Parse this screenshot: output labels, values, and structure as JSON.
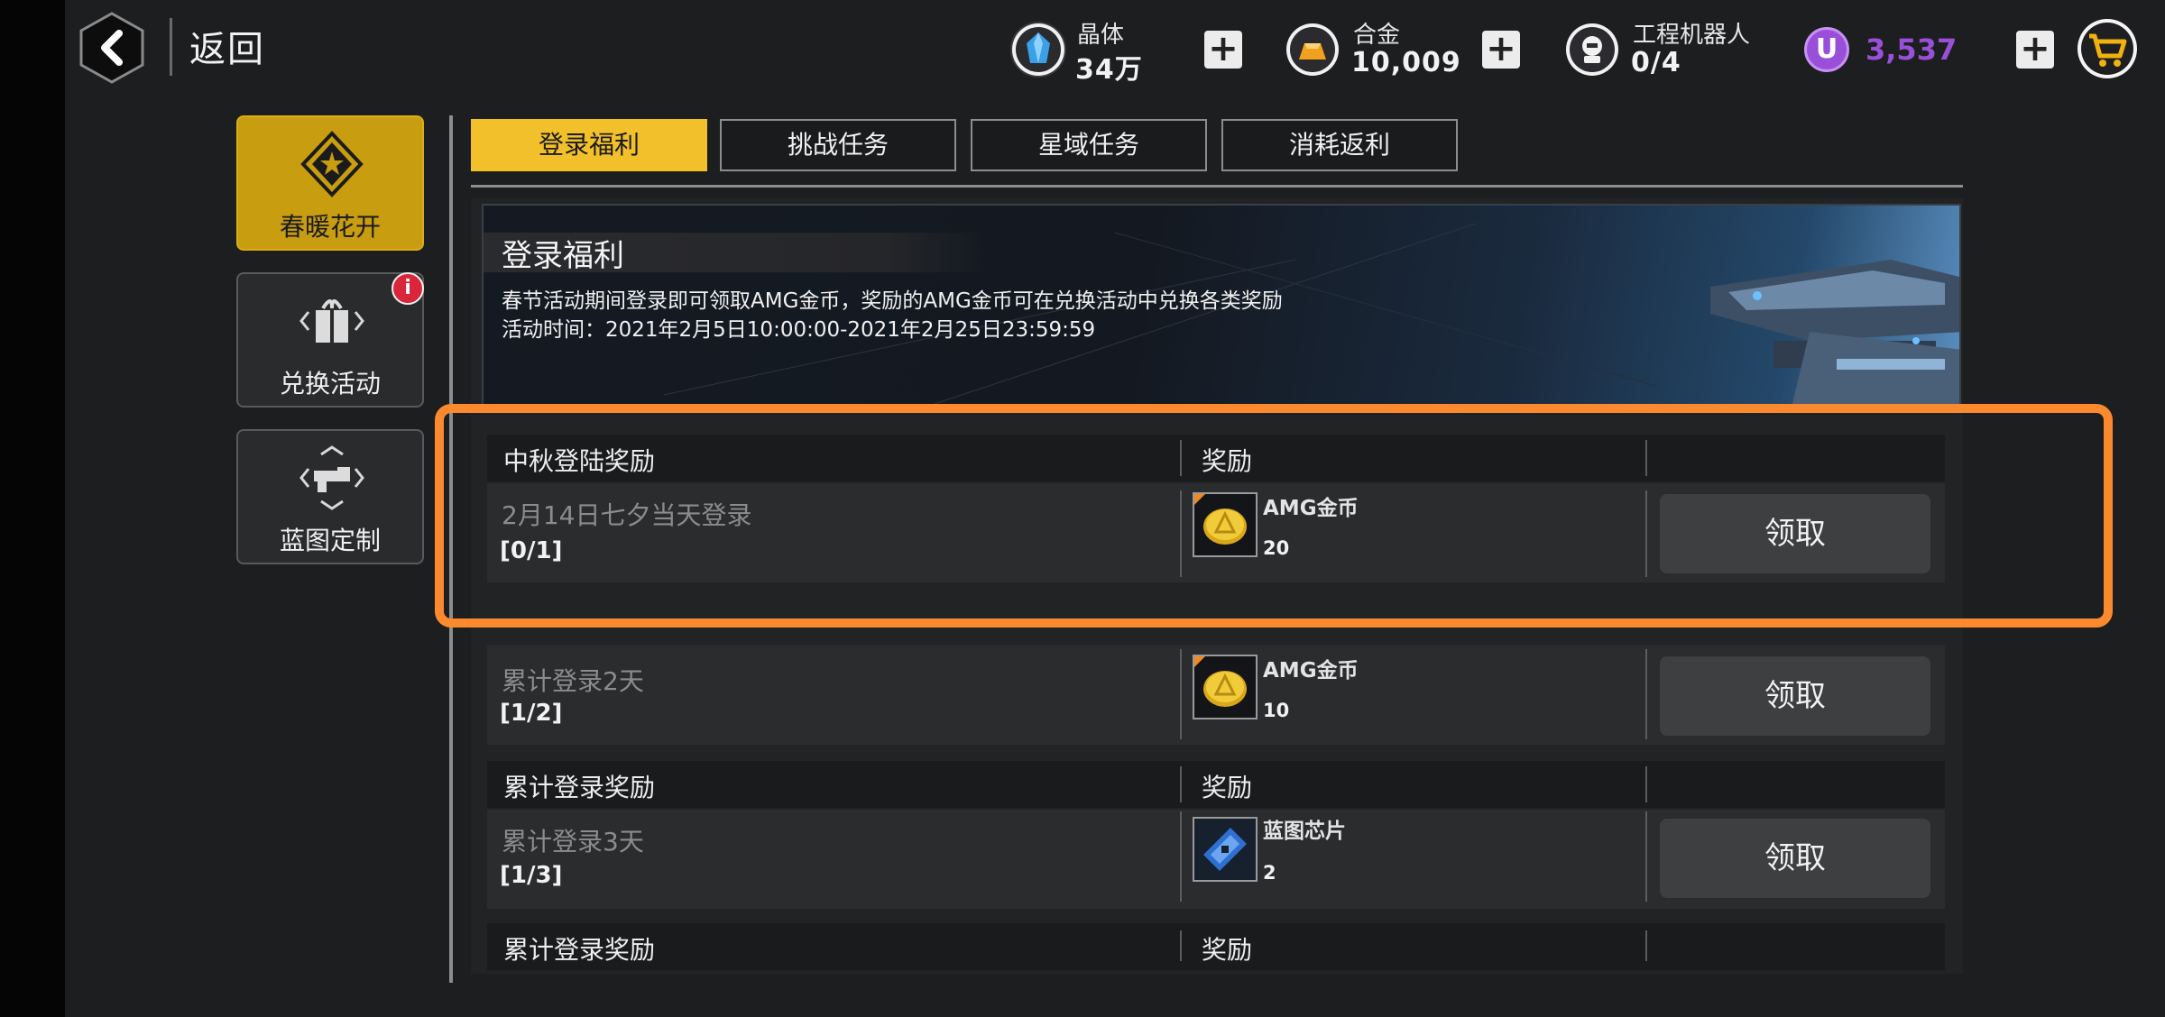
{
  "header": {
    "back_label": "返回",
    "resources": [
      {
        "icon": "crystal-icon",
        "name": "晶体",
        "value": "34万",
        "color": "#3aa0e8"
      },
      {
        "icon": "alloy-icon",
        "name": "合金",
        "value": "10,009",
        "color": "#f0a21f"
      },
      {
        "icon": "robot-icon",
        "name": "工程机器人",
        "value": "0/4",
        "color": "#ffffff"
      }
    ],
    "currency": {
      "icon": "u-coin-icon",
      "symbol": "U",
      "value": "3,537",
      "color": "#9a4fd9"
    },
    "plus_symbol": "+"
  },
  "sidebar": {
    "items": [
      {
        "label": "春暖花开",
        "icon": "star-emblem-icon",
        "active": true
      },
      {
        "label": "兑换活动",
        "icon": "gift-icon",
        "active": false,
        "badge": "i"
      },
      {
        "label": "蓝图定制",
        "icon": "blueprint-gun-icon",
        "active": false
      }
    ]
  },
  "tabs": [
    {
      "label": "登录福利",
      "active": true
    },
    {
      "label": "挑战任务",
      "active": false
    },
    {
      "label": "星域任务",
      "active": false
    },
    {
      "label": "消耗返利",
      "active": false
    }
  ],
  "banner": {
    "title": "登录福利",
    "description": "春节活动期间登录即可领取AMG金币，奖励的AMG金币可在兑换活动中兑换各类奖励",
    "time": "活动时间：2021年2月5日10:00:00-2021年2月25日23:59:59"
  },
  "sections": [
    {
      "header": {
        "title": "中秋登陆奖励",
        "reward": "奖励"
      },
      "items": [
        {
          "task": "2月14日七夕当天登录",
          "progress": "[0/1]",
          "reward_name": "AMG金币",
          "reward_qty": "20",
          "reward_icon": "gold-coin-icon",
          "button": "领取"
        },
        {
          "task": "累计登录2天",
          "progress": "[1/2]",
          "reward_name": "AMG金币",
          "reward_qty": "10",
          "reward_icon": "gold-coin-icon",
          "button": "领取"
        }
      ]
    },
    {
      "header": {
        "title": "累计登录奖励",
        "reward": "奖励"
      },
      "items": [
        {
          "task": "累计登录3天",
          "progress": "[1/3]",
          "reward_name": "蓝图芯片",
          "reward_qty": "2",
          "reward_icon": "blueprint-chip-icon",
          "button": "领取"
        }
      ]
    },
    {
      "header": {
        "title": "累计登录奖励",
        "reward": "奖励"
      },
      "items": []
    }
  ]
}
